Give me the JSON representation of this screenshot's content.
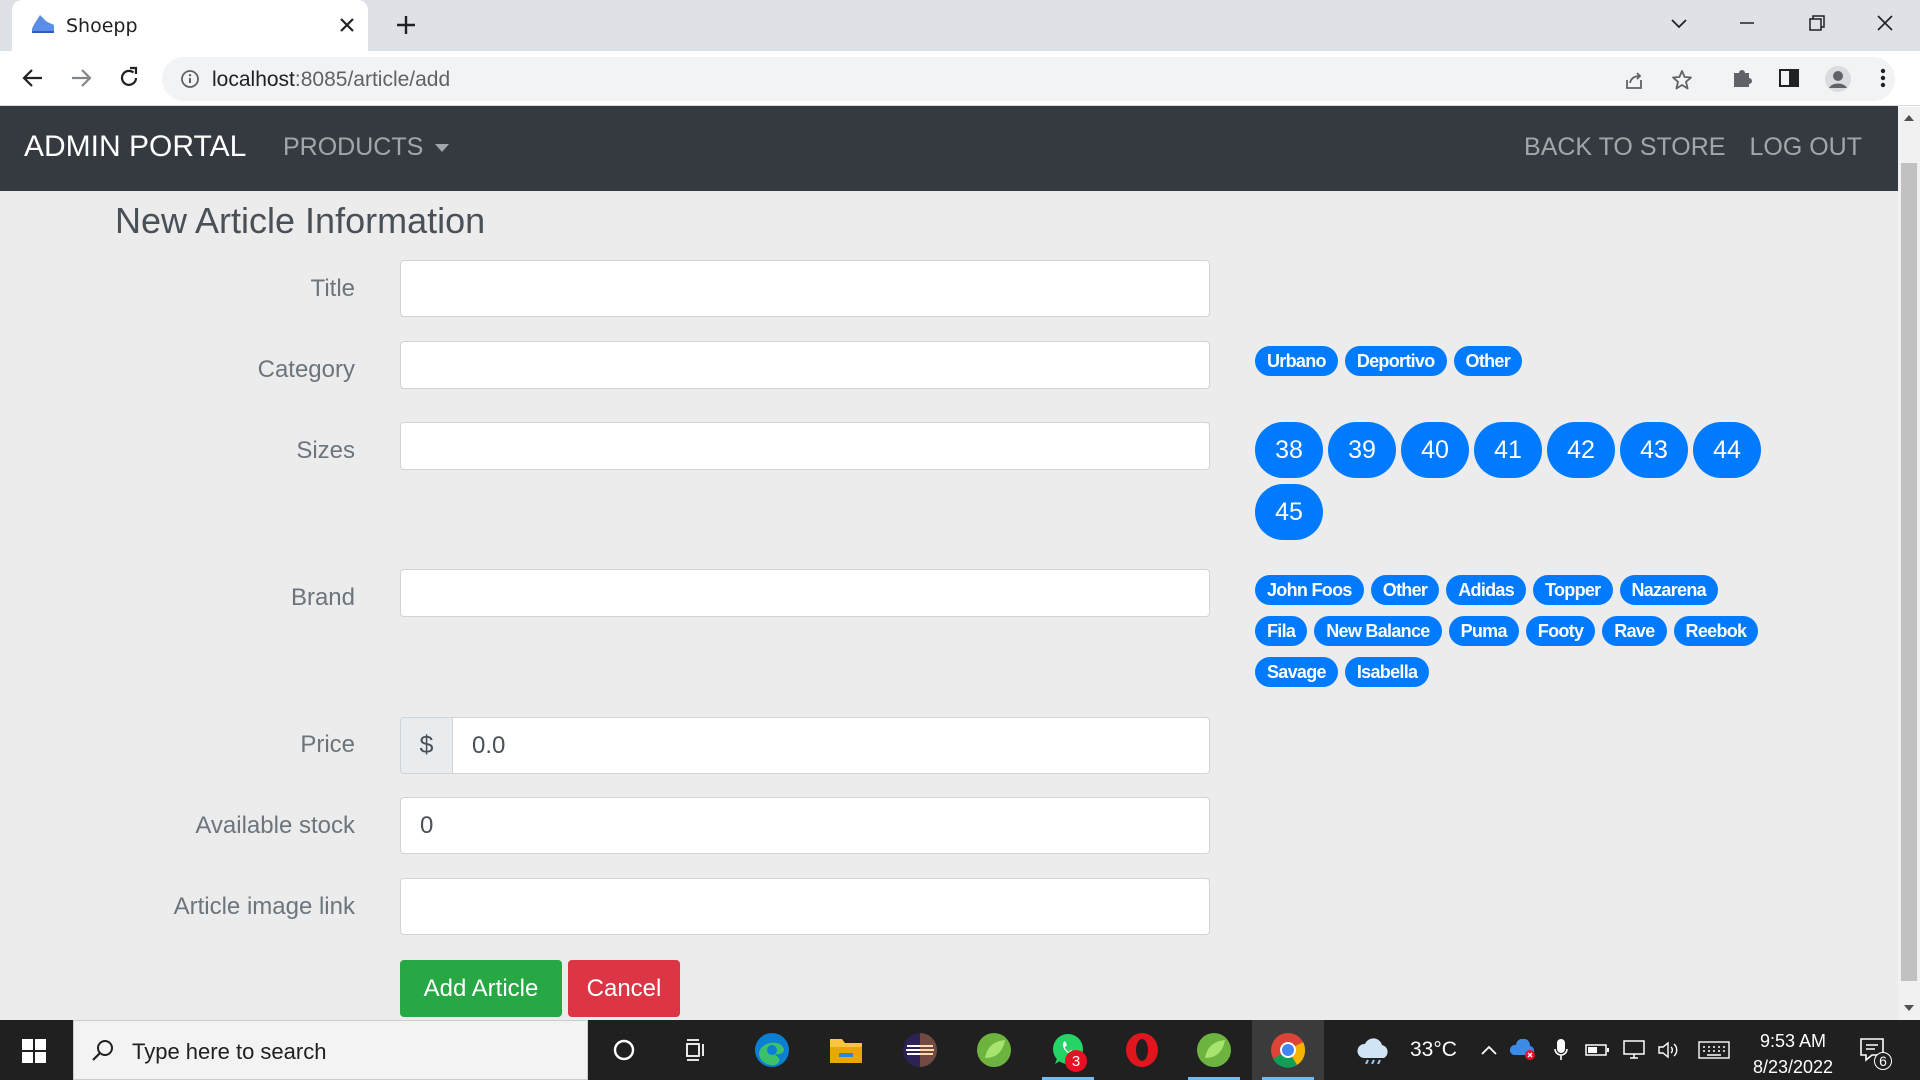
{
  "browser": {
    "tab_title": "Shoepp",
    "url_host": "localhost",
    "url_path": ":8085/article/add"
  },
  "navbar": {
    "brand": "ADMIN PORTAL",
    "products": "PRODUCTS",
    "back_to_store": "BACK TO STORE",
    "log_out": "LOG OUT"
  },
  "form": {
    "heading": "New Article Information",
    "labels": {
      "title": "Title",
      "category": "Category",
      "sizes": "Sizes",
      "brand": "Brand",
      "price": "Price",
      "stock": "Available stock",
      "image": "Article image link"
    },
    "values": {
      "title": "",
      "category": "",
      "sizes": "",
      "brand": "",
      "price": "0.0",
      "stock": "0",
      "image": ""
    },
    "currency": "$",
    "categories": [
      "Urbano",
      "Deportivo",
      "Other"
    ],
    "sizes": [
      "38",
      "39",
      "40",
      "41",
      "42",
      "43",
      "44",
      "45"
    ],
    "brands": [
      "John Foos",
      "Other",
      "Adidas",
      "Topper",
      "Nazarena",
      "Fila",
      "New Balance",
      "Puma",
      "Footy",
      "Rave",
      "Reebok",
      "Savage",
      "Isabella"
    ],
    "add_button": "Add Article",
    "cancel_button": "Cancel"
  },
  "taskbar": {
    "search_placeholder": "Type here to search",
    "whatsapp_badge": "3",
    "temperature": "33°C",
    "time": "9:53 AM",
    "date": "8/23/2022",
    "notifications": "6"
  },
  "colors": {
    "navbar": "#343a40",
    "primary": "#007bff",
    "success": "#28a745",
    "danger": "#dc3545"
  }
}
